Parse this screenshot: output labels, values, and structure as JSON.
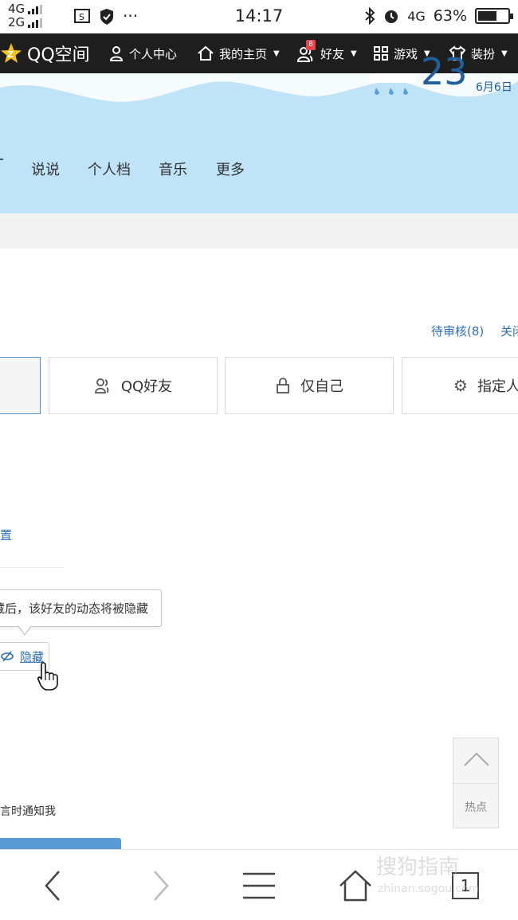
{
  "status_bar": {
    "signal_top": "4G",
    "signal_bottom": "2G",
    "more": "···",
    "time": "14:17",
    "network": "4G",
    "battery": "63%",
    "battery_level": 0.63
  },
  "top_nav": {
    "logo": "QQ空间",
    "items": [
      {
        "label": "个人中心",
        "icon": "person-icon"
      },
      {
        "label": "我的主页",
        "icon": "home-icon"
      },
      {
        "label": "好友",
        "icon": "friends-icon",
        "badge": "8"
      },
      {
        "label": "游戏",
        "icon": "grid-icon"
      },
      {
        "label": "装扮",
        "icon": "shirt-icon"
      }
    ]
  },
  "banner": {
    "temperature": "23",
    "date": "6月6日",
    "tabs": [
      "说说",
      "个人档",
      "音乐",
      "更多"
    ]
  },
  "links": {
    "pending": "待审核(8)",
    "close_partial": "关闭",
    "settings_partial": "置",
    "notify_partial": "言时通知我"
  },
  "permissions": [
    {
      "label": "",
      "icon": ""
    },
    {
      "label": "QQ好友",
      "icon": "friend-icon"
    },
    {
      "label": "仅自己",
      "icon": "lock-icon"
    },
    {
      "label": "指定人",
      "icon": "gear-icon"
    }
  ],
  "tooltip": {
    "text": "藏后，该好友的动态将被隐藏",
    "button": "隐藏"
  },
  "back_to_top": {
    "hot_label": "热点"
  },
  "watermark": {
    "main": "搜狗指南",
    "sub": "zhinan.sogou.com"
  },
  "bottom_bar": {
    "tab_count": "1"
  }
}
